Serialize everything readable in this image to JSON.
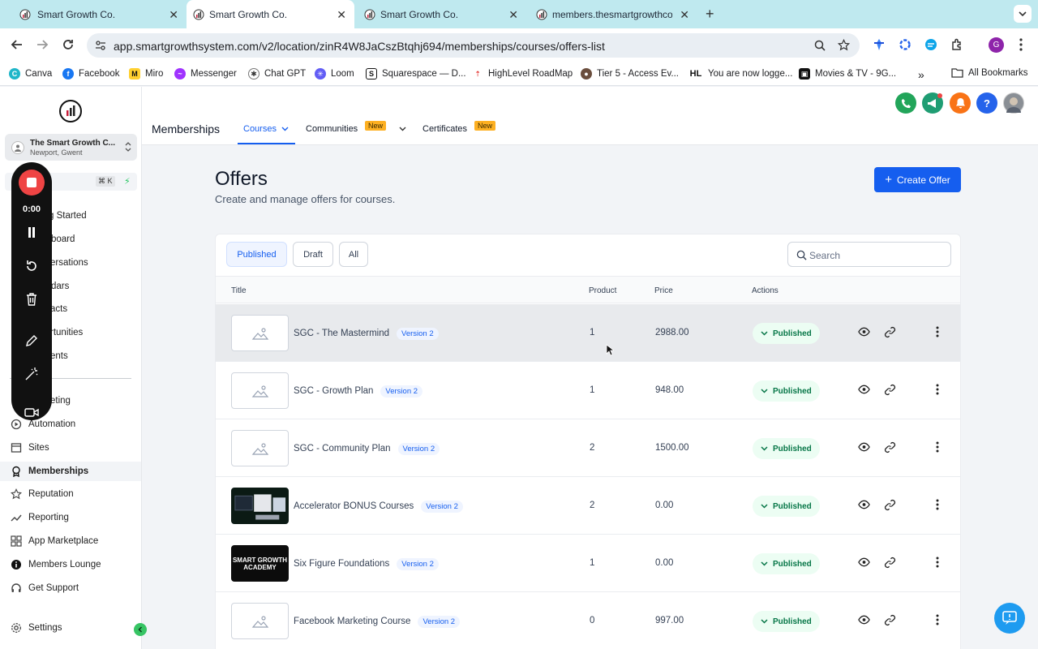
{
  "browser": {
    "tabs": [
      {
        "title": "Smart Growth Co."
      },
      {
        "title": "Smart Growth Co."
      },
      {
        "title": "Smart Growth Co."
      },
      {
        "title": "members.thesmartgrowthco.c"
      }
    ],
    "url": "app.smartgrowthsystem.com/v2/location/zinR4W8JaCszBtqhj694/memberships/courses/offers-list",
    "profile_initial": "G",
    "bookmarks": [
      {
        "label": "Canva",
        "icon": "canva-icon"
      },
      {
        "label": "Facebook",
        "icon": "facebook-icon"
      },
      {
        "label": "Miro",
        "icon": "miro-icon"
      },
      {
        "label": "Messenger",
        "icon": "messenger-icon"
      },
      {
        "label": "Chat GPT",
        "icon": "chatgpt-icon"
      },
      {
        "label": "Loom",
        "icon": "loom-icon"
      },
      {
        "label": "Squarespace — D...",
        "icon": "squarespace-icon"
      },
      {
        "label": "HighLevel RoadMap",
        "icon": "highlevel-icon"
      },
      {
        "label": "Tier 5 - Access Ev...",
        "icon": "tier5-icon"
      },
      {
        "label": "You are now logge...",
        "icon": "hl-icon"
      },
      {
        "label": "Movies & TV - 9G...",
        "icon": "movies-icon"
      }
    ],
    "all_bookmarks": "All Bookmarks"
  },
  "sidebar": {
    "account_name": "The Smart Growth C...",
    "account_location": "Newport, Gwent",
    "search_shortcut": "⌘ K",
    "partial_items": [
      {
        "label": "g Started"
      },
      {
        "label": "board"
      },
      {
        "label": "ersations"
      },
      {
        "label": "dars"
      },
      {
        "label": "acts"
      },
      {
        "label": "rtunities"
      },
      {
        "label": "ents"
      }
    ],
    "marketing_partial": "eting",
    "items": [
      {
        "label": "Automation",
        "icon": "automation-icon"
      },
      {
        "label": "Sites",
        "icon": "sites-icon"
      },
      {
        "label": "Memberships",
        "icon": "memberships-icon"
      },
      {
        "label": "Reputation",
        "icon": "reputation-icon"
      },
      {
        "label": "Reporting",
        "icon": "reporting-icon"
      },
      {
        "label": "App Marketplace",
        "icon": "app-marketplace-icon"
      },
      {
        "label": "Members Lounge",
        "icon": "members-lounge-icon"
      },
      {
        "label": "Get Support",
        "icon": "support-icon"
      }
    ],
    "settings_label": "Settings"
  },
  "recorder": {
    "timer": "0:00"
  },
  "header": {
    "title": "Memberships",
    "tabs": [
      {
        "label": "Courses"
      },
      {
        "label": "Communities",
        "badge": "New"
      },
      {
        "label": "Certificates",
        "badge": "New"
      }
    ]
  },
  "page": {
    "title": "Offers",
    "subtitle": "Create and manage offers for courses.",
    "create_button": "Create Offer"
  },
  "filters": {
    "tabs": [
      "Published",
      "Draft",
      "All"
    ],
    "selected": "Published",
    "search_placeholder": "Search"
  },
  "table": {
    "columns": [
      "Title",
      "Product",
      "Price",
      "Actions"
    ],
    "rows": [
      {
        "title": "SGC - The Mastermind",
        "version": "Version 2",
        "product": "1",
        "price": "2988.00",
        "status": "Published",
        "thumb": "placeholder"
      },
      {
        "title": "SGC - Growth Plan",
        "version": "Version 2",
        "product": "1",
        "price": "948.00",
        "status": "Published",
        "thumb": "placeholder"
      },
      {
        "title": "SGC - Community Plan",
        "version": "Version 2",
        "product": "2",
        "price": "1500.00",
        "status": "Published",
        "thumb": "placeholder"
      },
      {
        "title": "Accelerator BONUS Courses",
        "version": "Version 2",
        "product": "2",
        "price": "0.00",
        "status": "Published",
        "thumb": "screens"
      },
      {
        "title": "Six Figure Foundations",
        "version": "Version 2",
        "product": "1",
        "price": "0.00",
        "status": "Published",
        "thumb": "academy"
      },
      {
        "title": "Facebook Marketing Course",
        "version": "Version 2",
        "product": "0",
        "price": "997.00",
        "status": "Published",
        "thumb": "placeholder"
      }
    ],
    "thumb_text": "SMART GROWTH ACADEMY"
  },
  "colors": {
    "accent": "#155eef",
    "published_bg": "#ecfdf3",
    "published_text": "#067647",
    "recorder": "#ef4444"
  }
}
